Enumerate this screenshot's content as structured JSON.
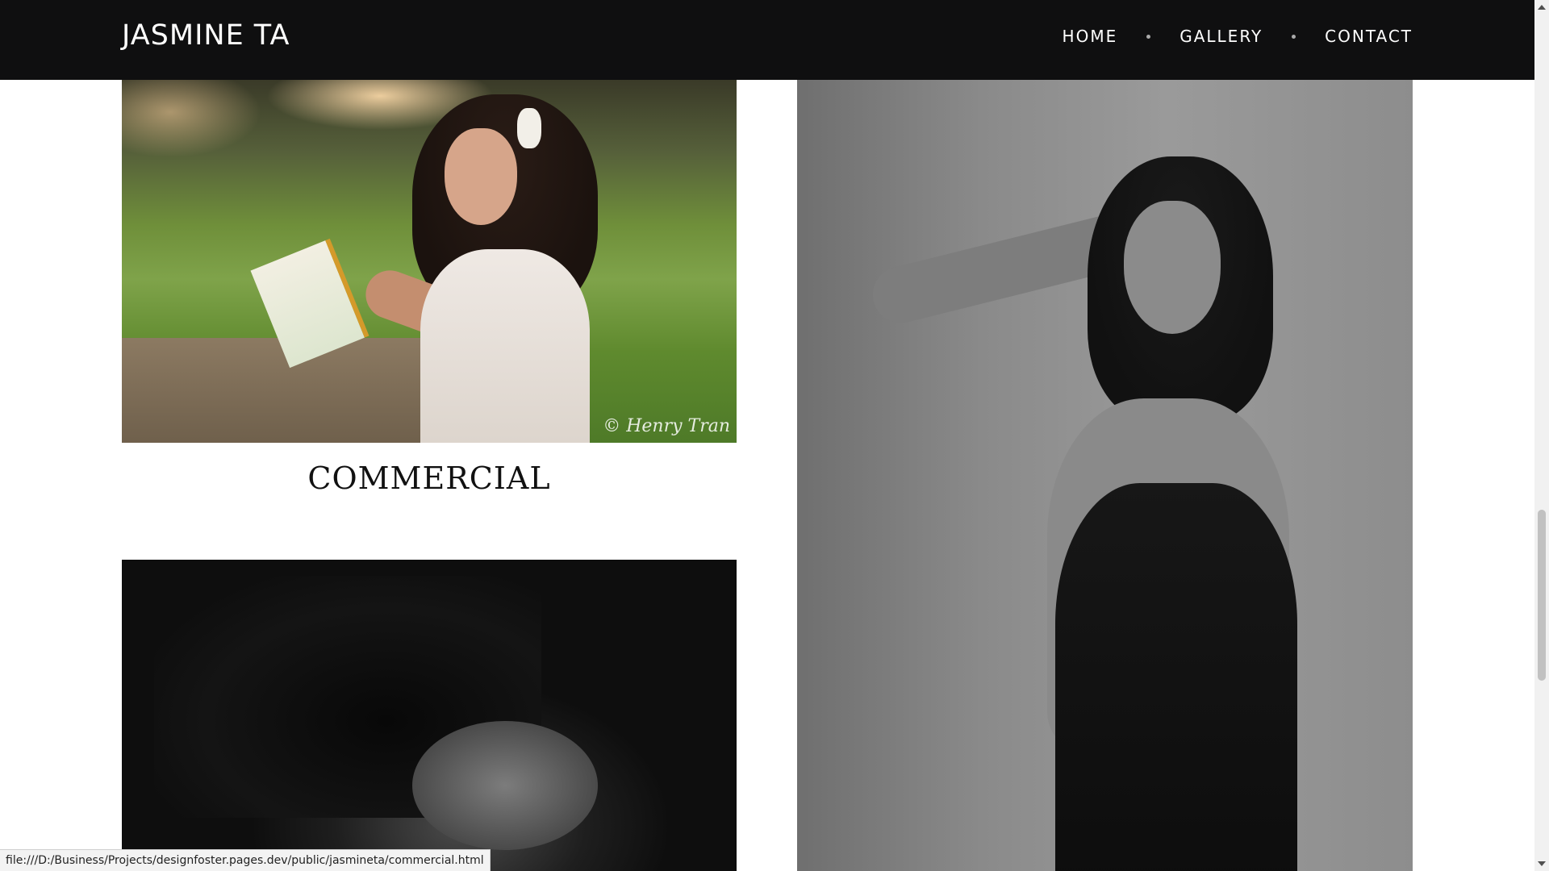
{
  "header": {
    "brand": "JASMINE TA",
    "nav": [
      {
        "label": "HOME"
      },
      {
        "label": "GALLERY"
      },
      {
        "label": "CONTACT"
      }
    ]
  },
  "gallery": {
    "section_title": "COMMERCIAL",
    "photo_1_watermark": "© Henry Tran"
  },
  "status_bar": {
    "url": "file:///D:/Business/Projects/designfoster.pages.dev/public/jasmineta/commercial.html"
  }
}
